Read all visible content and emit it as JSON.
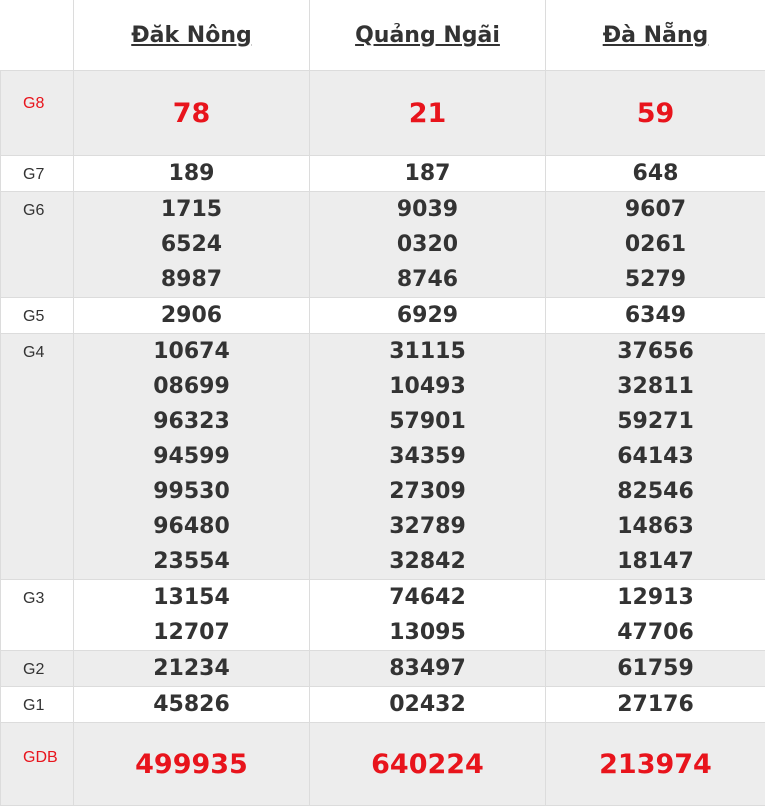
{
  "provinces": [
    "Đăk Nông",
    "Quảng Ngãi",
    "Đà Nẵng"
  ],
  "prizes": [
    {
      "label": "G8",
      "values": [
        [
          "78"
        ],
        [
          "21"
        ],
        [
          "59"
        ]
      ]
    },
    {
      "label": "G7",
      "values": [
        [
          "189"
        ],
        [
          "187"
        ],
        [
          "648"
        ]
      ]
    },
    {
      "label": "G6",
      "values": [
        [
          "1715",
          "6524",
          "8987"
        ],
        [
          "9039",
          "0320",
          "8746"
        ],
        [
          "9607",
          "0261",
          "5279"
        ]
      ]
    },
    {
      "label": "G5",
      "values": [
        [
          "2906"
        ],
        [
          "6929"
        ],
        [
          "6349"
        ]
      ]
    },
    {
      "label": "G4",
      "values": [
        [
          "10674",
          "08699",
          "96323",
          "94599",
          "99530",
          "96480",
          "23554"
        ],
        [
          "31115",
          "10493",
          "57901",
          "34359",
          "27309",
          "32789",
          "32842"
        ],
        [
          "37656",
          "32811",
          "59271",
          "64143",
          "82546",
          "14863",
          "18147"
        ]
      ]
    },
    {
      "label": "G3",
      "values": [
        [
          "13154",
          "12707"
        ],
        [
          "74642",
          "13095"
        ],
        [
          "12913",
          "47706"
        ]
      ]
    },
    {
      "label": "G2",
      "values": [
        [
          "21234"
        ],
        [
          "83497"
        ],
        [
          "61759"
        ]
      ]
    },
    {
      "label": "G1",
      "values": [
        [
          "45826"
        ],
        [
          "02432"
        ],
        [
          "27176"
        ]
      ]
    },
    {
      "label": "GDB",
      "values": [
        [
          "499935"
        ],
        [
          "640224"
        ],
        [
          "213974"
        ]
      ]
    }
  ],
  "colors": {
    "special": "#e8141c",
    "text": "#333333",
    "alt_row": "#ededed",
    "border": "#dcdcdc"
  }
}
